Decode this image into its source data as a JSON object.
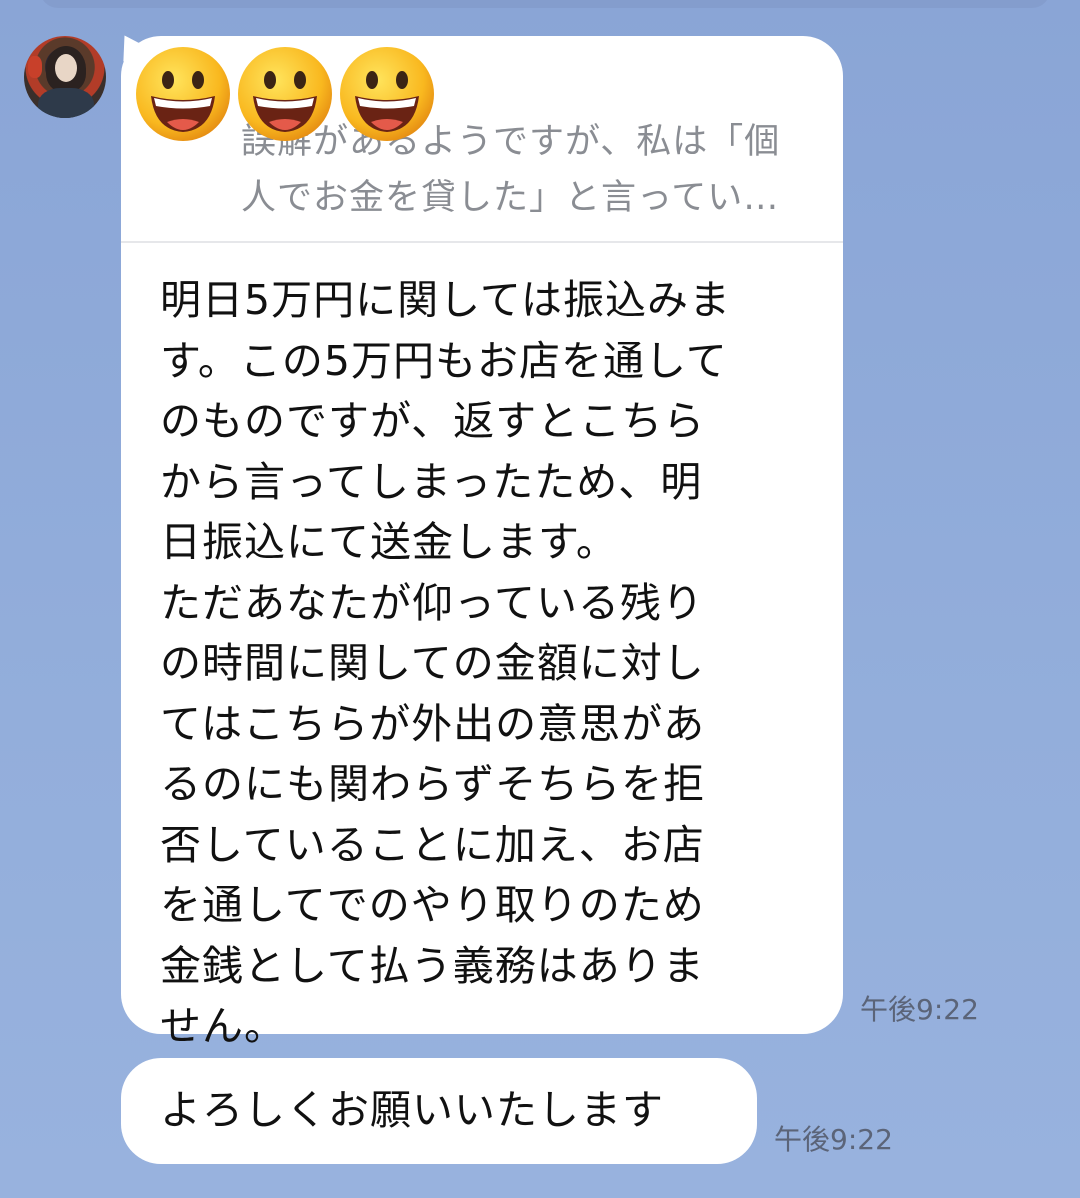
{
  "chat": {
    "messages": [
      {
        "sender": "other",
        "reply_preview": "誤解があるようですが、私は「個\n人でお金を貸した」と言ってい…",
        "emojis": [
          "grinning-face",
          "grinning-face",
          "grinning-face"
        ],
        "text": "明日5万円に関しては振込みま\nす。この5万円もお店を通して\nのものですが、返すとこちら\nから言ってしまったため、明\n日振込にて送金します。\nただあなたが仰っている残り\nの時間に関しての金額に対し\nてはこちらが外出の意思があ\nるのにも関わらずそちらを拒\n否していることに加え、お店\nを通してでのやり取りのため\n金銭として払う義務はありま\nせん。",
        "time": "午後9:22"
      },
      {
        "sender": "other",
        "text": "よろしくお願いいたします",
        "time": "午後9:22"
      }
    ]
  },
  "colors": {
    "background": "#8fa9d8",
    "bubble": "#ffffff",
    "text": "#111111",
    "preview_text": "#8a8d93",
    "timestamp": "#5b6478"
  }
}
